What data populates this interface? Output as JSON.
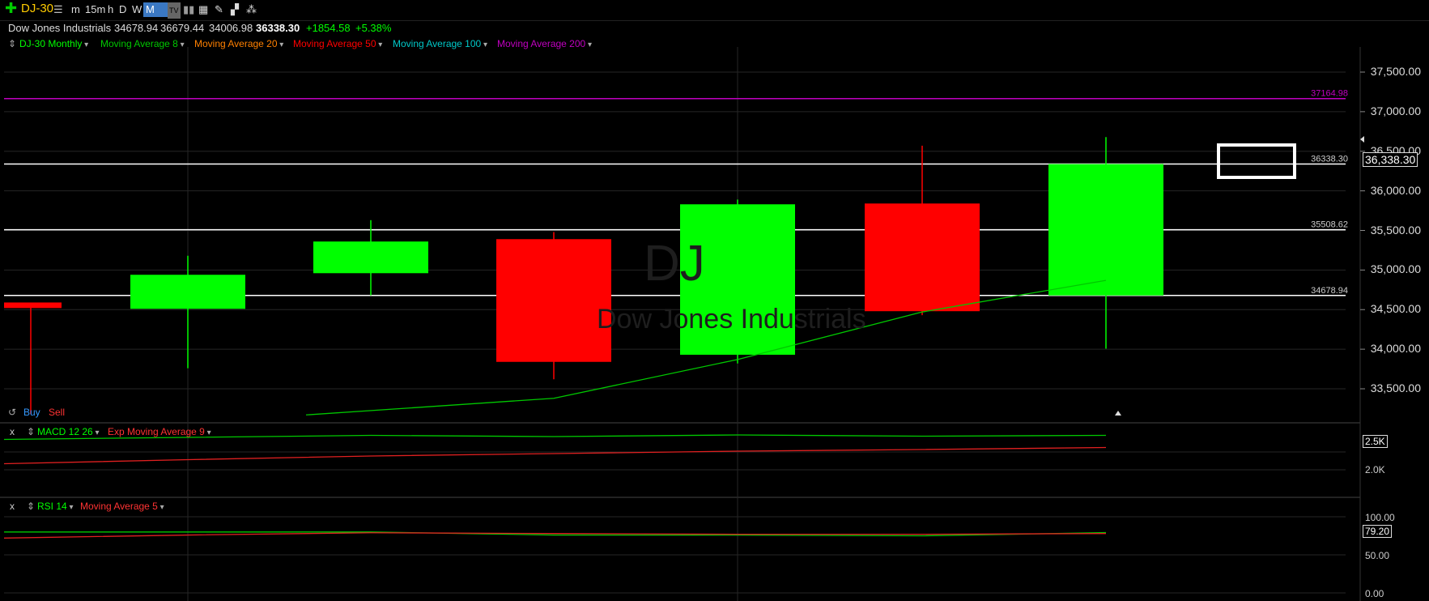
{
  "toolbar": {
    "symbol": "DJ-30",
    "intervals": [
      "m",
      "15m",
      "h",
      "D",
      "W",
      "M"
    ],
    "selected_interval": "M"
  },
  "quote": {
    "name": "Dow Jones Industrials",
    "open": "34678.94",
    "high": "36679.44",
    "low": "34006.98",
    "last": "36338.30",
    "change": "+1854.58",
    "change_pct": "+5.38%"
  },
  "indicators": {
    "main_label": "DJ-30 Monthly",
    "ma8": "Moving Average 8",
    "ma20": "Moving Average 20",
    "ma50": "Moving Average 50",
    "ma100": "Moving Average 100",
    "ma200": "Moving Average 200"
  },
  "watermark": {
    "symbol": "DJ",
    "name": "Dow Jones Industrials"
  },
  "trade": {
    "buy": "Buy",
    "sell": "Sell"
  },
  "macd": {
    "close": "x",
    "label": "MACD 12 26",
    "signal": "Exp Moving Average 9",
    "last": "2.5K",
    "tick": "2.0K"
  },
  "rsi": {
    "close": "x",
    "label": "RSI 14",
    "signal": "Moving Average 5",
    "last": "79.20",
    "ticks": [
      "100.00",
      "50.00",
      "0.00"
    ]
  },
  "colors": {
    "up": "#00ff00",
    "down": "#ff0000",
    "ma8": "#00c800",
    "ma200": "#c000c0",
    "ma20": "#ff8000",
    "ma100": "#00c8c8",
    "symbol": "#ffcc00",
    "buy": "#3399ff"
  },
  "chart_data": {
    "type": "candlestick",
    "title": "DJ-30 Monthly",
    "y_ticks": [
      "37,500.00",
      "37,000.00",
      "36,500.00",
      "36,000.00",
      "35,500.00",
      "35,000.00",
      "34,500.00",
      "34,000.00",
      "33,500.00"
    ],
    "ylim": [
      33200,
      37800
    ],
    "last_price_label": "36,338.30",
    "candles": [
      {
        "open": 34590,
        "high": 34590,
        "low": 33180,
        "close": 34520,
        "dir": "down"
      },
      {
        "open": 34510,
        "high": 35180,
        "low": 33760,
        "close": 34940,
        "dir": "up"
      },
      {
        "open": 34960,
        "high": 35630,
        "low": 34680,
        "close": 35360,
        "dir": "up"
      },
      {
        "open": 35390,
        "high": 35480,
        "low": 33620,
        "close": 33840,
        "dir": "down"
      },
      {
        "open": 33930,
        "high": 35890,
        "low": 33820,
        "close": 35830,
        "dir": "up"
      },
      {
        "open": 35840,
        "high": 36570,
        "low": 34430,
        "close": 34480,
        "dir": "down"
      },
      {
        "open": 34678.94,
        "high": 36679.44,
        "low": 34006.98,
        "close": 36338.3,
        "dir": "up"
      }
    ],
    "ma8": [
      null,
      null,
      33170,
      33380,
      33870,
      34470,
      34870
    ],
    "hlines": [
      {
        "value": 37164.98,
        "label": "37164.98",
        "color": "#c000c0"
      },
      {
        "value": 36338.3,
        "label": "36338.30",
        "color": "#ffffff"
      },
      {
        "value": 35508.62,
        "label": "35508.62",
        "color": "#ffffff"
      },
      {
        "value": 34678.94,
        "label": "34678.94",
        "color": "#ffffff"
      }
    ],
    "macd_line": [
      2.35,
      2.4,
      2.45,
      2.42,
      2.46,
      2.43,
      2.45
    ],
    "macd_signal": [
      1.75,
      1.85,
      1.94,
      2.0,
      2.06,
      2.1,
      2.15
    ],
    "rsi_line": [
      80,
      80,
      80,
      76,
      76,
      75,
      79.2
    ],
    "rsi_signal": [
      72,
      76,
      79,
      78,
      77,
      77,
      78
    ]
  }
}
